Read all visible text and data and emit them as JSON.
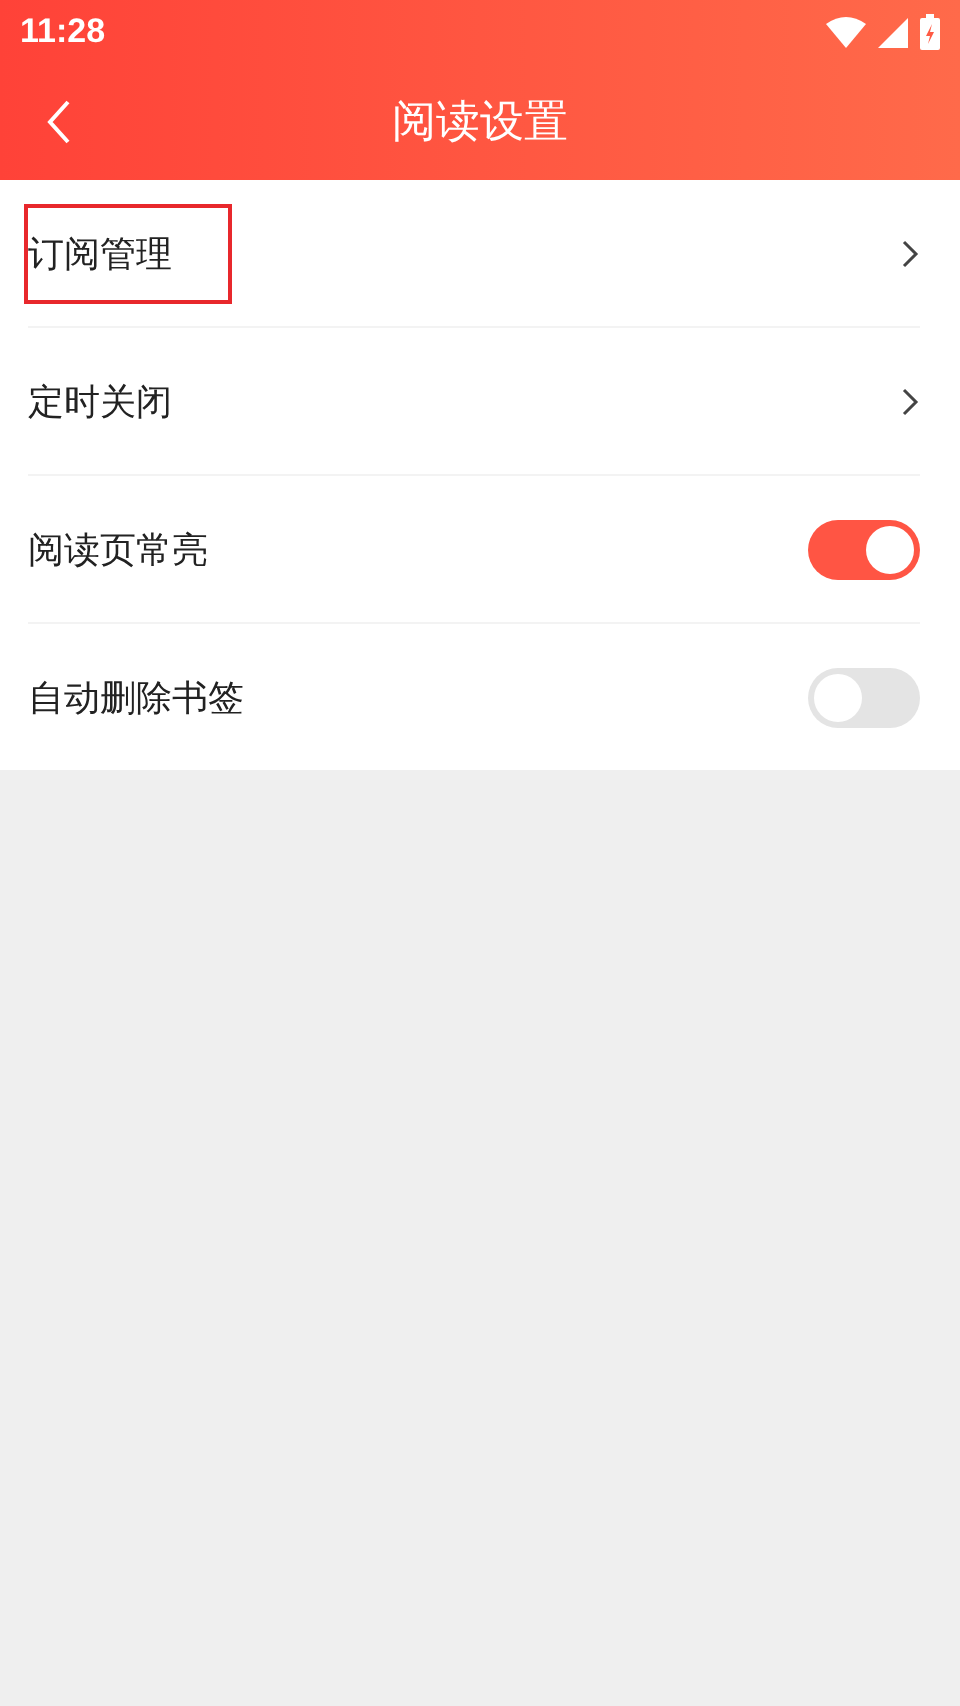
{
  "status_bar": {
    "time": "11:28"
  },
  "toolbar": {
    "title": "阅读设置"
  },
  "settings": [
    {
      "kind": "link",
      "label": "订阅管理",
      "highlighted": true
    },
    {
      "kind": "link",
      "label": "定时关闭",
      "highlighted": false
    },
    {
      "kind": "toggle",
      "label": "阅读页常亮",
      "on": true
    },
    {
      "kind": "toggle",
      "label": "自动删除书签",
      "on": false
    }
  ]
}
